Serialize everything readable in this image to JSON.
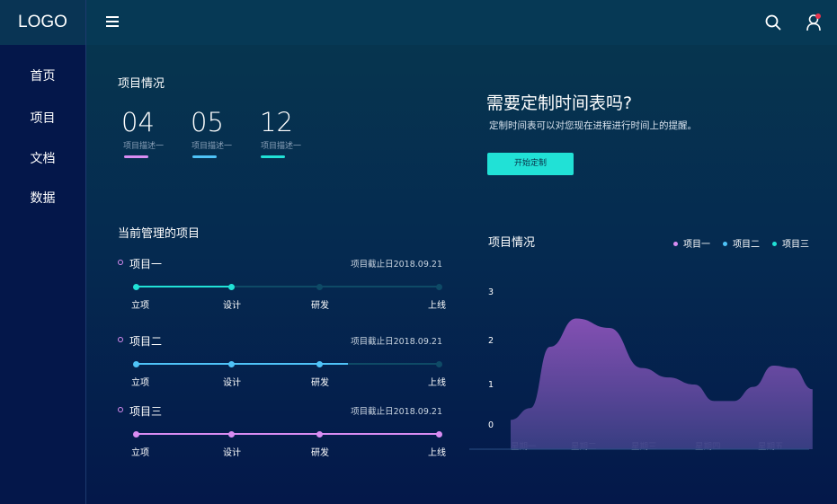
{
  "logo": "LOGO",
  "nav": [
    "首页",
    "项目",
    "文档",
    "数据"
  ],
  "header": {
    "menu_icon": "hamburger-menu-icon",
    "search_icon": "search-icon",
    "user_icon": "user-icon",
    "notification_color": "#e8344e"
  },
  "overview": {
    "title": "项目情况",
    "stats": [
      {
        "value": "04",
        "desc": "项目描述一",
        "color": "#d98cf2"
      },
      {
        "value": "05",
        "desc": "项目描述一",
        "color": "#4fc3f7"
      },
      {
        "value": "12",
        "desc": "项目描述一",
        "color": "#21e1d6"
      }
    ]
  },
  "promo": {
    "title": "需要定制时间表吗?",
    "subtitle": "定制时间表可以对您现在进程进行时间上的提醒。",
    "button": "开始定制"
  },
  "projects": {
    "title": "当前管理的项目",
    "stages": [
      "立项",
      "设计",
      "研发",
      "上线"
    ],
    "items": [
      {
        "name": "项目一",
        "deadline": "项目截止日2018.09.21",
        "color": "#21e1d6",
        "progress": 0.32
      },
      {
        "name": "项目二",
        "deadline": "项目截止日2018.09.21",
        "color": "#4fc3f7",
        "progress": 0.7
      },
      {
        "name": "项目三",
        "deadline": "项目截止日2018.09.21",
        "color": "#d98cf2",
        "progress": 1.0
      }
    ]
  },
  "chart_data": {
    "type": "area",
    "title": "项目情况",
    "legend_position": "top-right",
    "series": [
      {
        "name": "项目一",
        "color": "#d98cf2"
      },
      {
        "name": "项目二",
        "color": "#4fc3f7"
      },
      {
        "name": "项目三",
        "color": "#21e1d6"
      }
    ],
    "y_ticks": [
      "0",
      "1",
      "2",
      "3"
    ],
    "x_ticks": [
      "星期一",
      "星期二",
      "星期三",
      "星期四",
      "星期五"
    ],
    "ylim": [
      0,
      3
    ],
    "area_x": [
      0,
      0.3,
      0.6,
      1.0,
      1.5,
      2.0,
      2.4,
      2.8,
      3.1,
      3.4,
      3.7,
      4.0,
      4.3,
      4.6
    ],
    "area_y": [
      0.05,
      0.3,
      1.6,
      2.2,
      2.0,
      1.15,
      0.95,
      0.8,
      0.45,
      0.45,
      0.75,
      1.2,
      1.15,
      0.7
    ]
  }
}
